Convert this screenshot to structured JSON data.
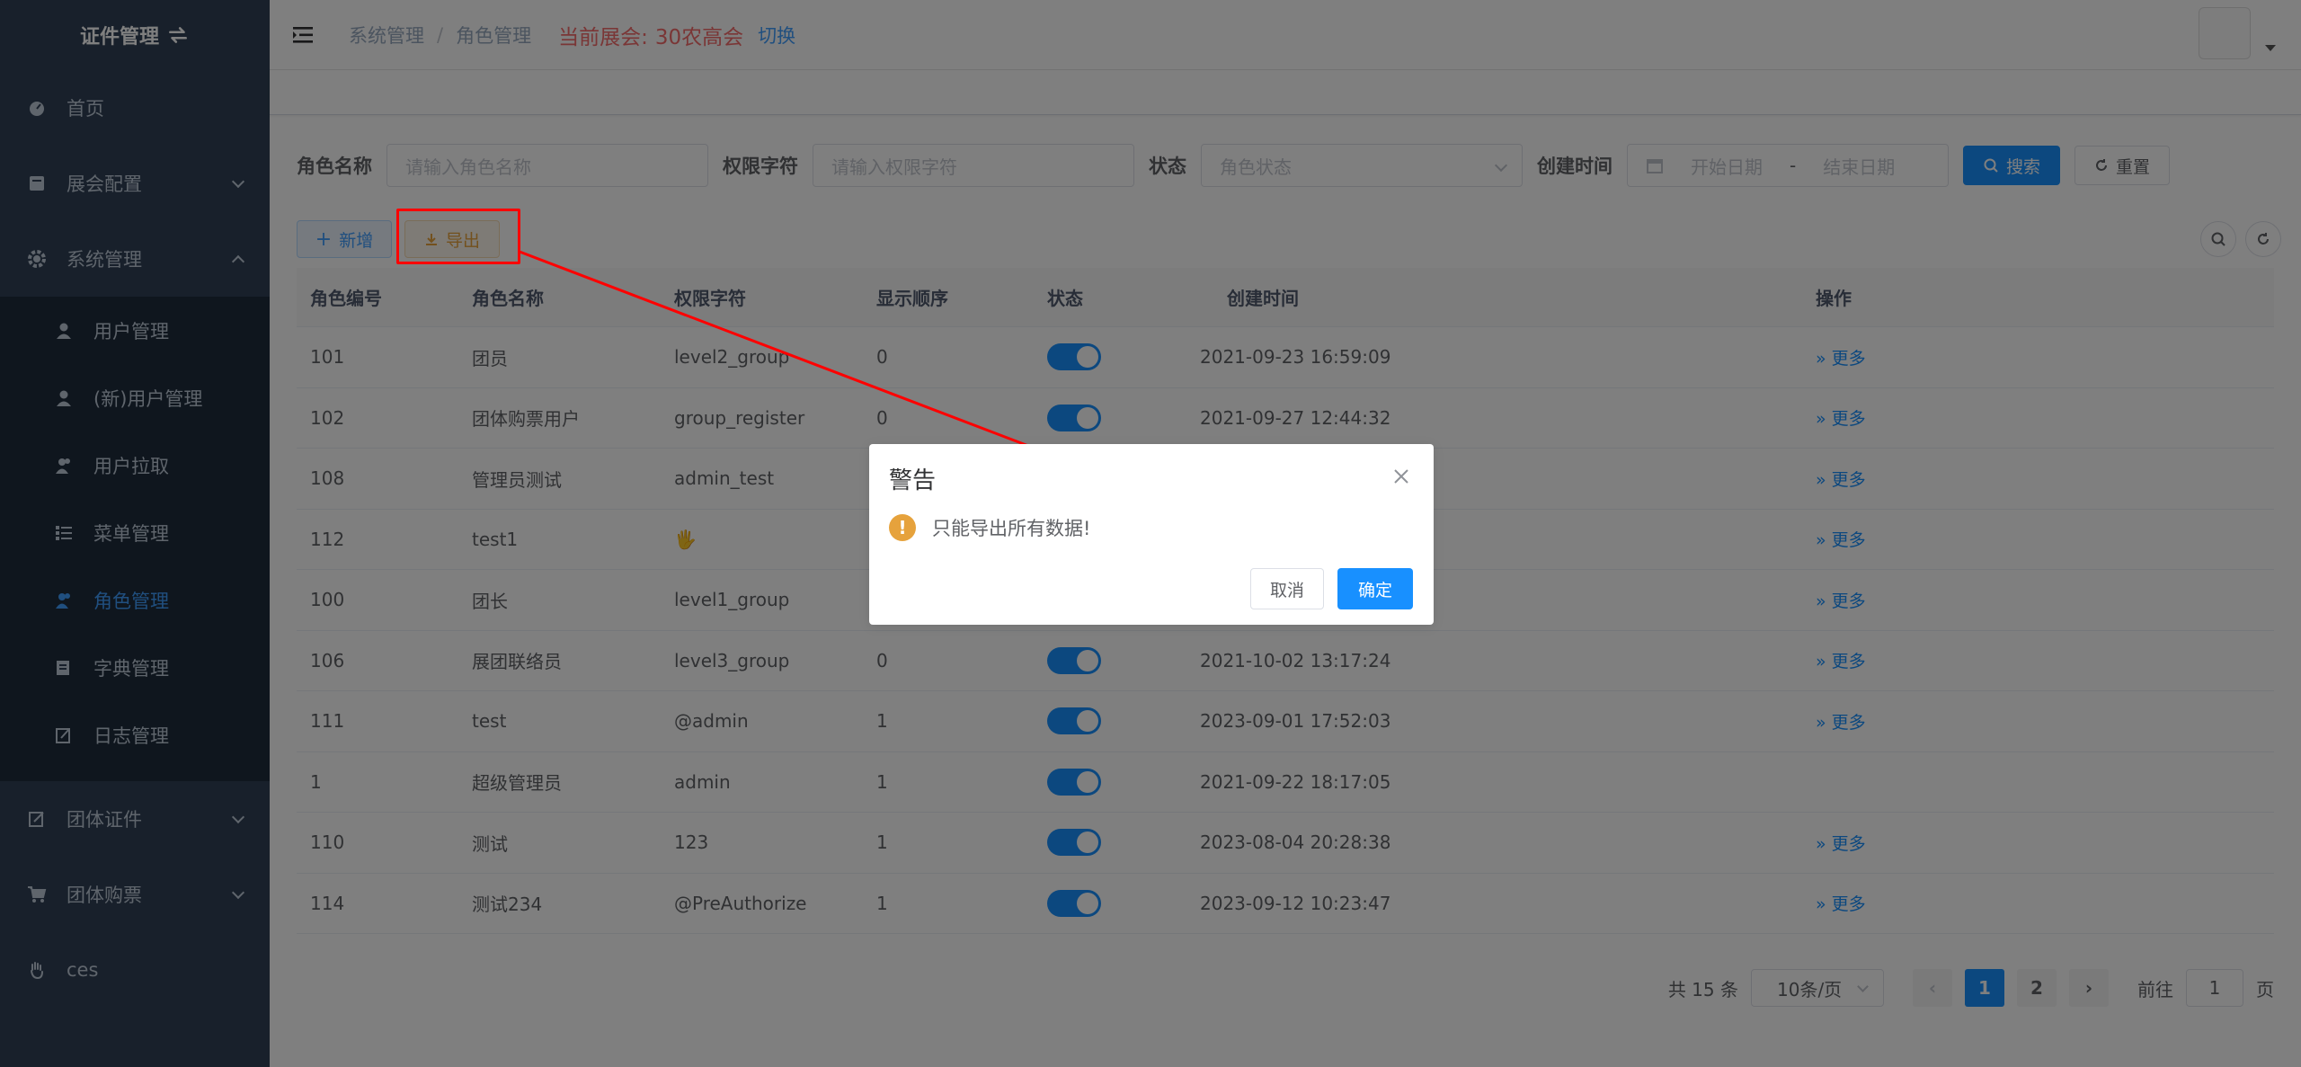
{
  "sidebar": {
    "logo_text": "证件管理",
    "items": [
      {
        "label": "首页"
      },
      {
        "label": "展会配置"
      },
      {
        "label": "系统管理"
      },
      {
        "label": "团体证件"
      },
      {
        "label": "团体购票"
      },
      {
        "label": "ces"
      }
    ],
    "sub_items": [
      {
        "label": "用户管理"
      },
      {
        "label": "(新)用户管理"
      },
      {
        "label": "用户拉取"
      },
      {
        "label": "菜单管理"
      },
      {
        "label": "角色管理"
      },
      {
        "label": "字典管理"
      },
      {
        "label": "日志管理"
      }
    ]
  },
  "header": {
    "breadcrumb": [
      "系统管理",
      "角色管理"
    ],
    "breadcrumb_sep": "/",
    "expo_label": "当前展会:",
    "expo_name": "30农高会",
    "switch_label": "切换"
  },
  "search": {
    "role_name_label": "角色名称",
    "role_name_placeholder": "请输入角色名称",
    "perm_label": "权限字符",
    "perm_placeholder": "请输入权限字符",
    "status_label": "状态",
    "status_placeholder": "角色状态",
    "date_label": "创建时间",
    "date_start": "开始日期",
    "date_sep": "-",
    "date_end": "结束日期",
    "search_btn": "搜索",
    "reset_btn": "重置"
  },
  "toolbar": {
    "add_label": "新增",
    "export_label": "导出"
  },
  "table": {
    "headers": [
      "角色编号",
      "角色名称",
      "权限字符",
      "显示顺序",
      "状态",
      "创建时间",
      "操作"
    ],
    "more_label": "更多",
    "rows": [
      {
        "id": "101",
        "name": "团员",
        "key": "level2_group",
        "sort": "0",
        "status": true,
        "time": "2021-09-23 16:59:09",
        "more": true
      },
      {
        "id": "102",
        "name": "团体购票用户",
        "key": "group_register",
        "sort": "0",
        "status": true,
        "time": "2021-09-27 12:44:32",
        "more": true
      },
      {
        "id": "108",
        "name": "管理员测试",
        "key": "admin_test",
        "sort": "",
        "status": true,
        "time": "",
        "more": true
      },
      {
        "id": "112",
        "name": "test1",
        "key": "🖐",
        "sort": "",
        "status": true,
        "time": "",
        "more": true
      },
      {
        "id": "100",
        "name": "团长",
        "key": "level1_group",
        "sort": "",
        "status": true,
        "time": "",
        "more": true
      },
      {
        "id": "106",
        "name": "展团联络员",
        "key": "level3_group",
        "sort": "0",
        "status": true,
        "time": "2021-10-02 13:17:24",
        "more": true
      },
      {
        "id": "111",
        "name": "test",
        "key": "@admin",
        "sort": "1",
        "status": true,
        "time": "2023-09-01 17:52:03",
        "more": true
      },
      {
        "id": "1",
        "name": "超级管理员",
        "key": "admin",
        "sort": "1",
        "status": true,
        "time": "2021-09-22 18:17:05",
        "more": false
      },
      {
        "id": "110",
        "name": "测试",
        "key": "123",
        "sort": "1",
        "status": true,
        "time": "2023-08-04 20:28:38",
        "more": true
      },
      {
        "id": "114",
        "name": "测试234",
        "key": "@PreAuthorize",
        "sort": "1",
        "status": true,
        "time": "2023-09-12 10:23:47",
        "more": true
      }
    ]
  },
  "pagination": {
    "total_text": "共 15 条",
    "page_size": "10条/页",
    "pages": [
      "1",
      "2"
    ],
    "current_page": "1",
    "goto_label": "前往",
    "goto_value": "1",
    "page_suffix": "页"
  },
  "dialog": {
    "title": "警告",
    "message": "只能导出所有数据!",
    "cancel_label": "取消",
    "confirm_label": "确定"
  },
  "colors": {
    "sidebar_bg": "#304156",
    "primary": "#1890ff",
    "warning": "#e6a23c",
    "annotation": "#ff0000"
  }
}
